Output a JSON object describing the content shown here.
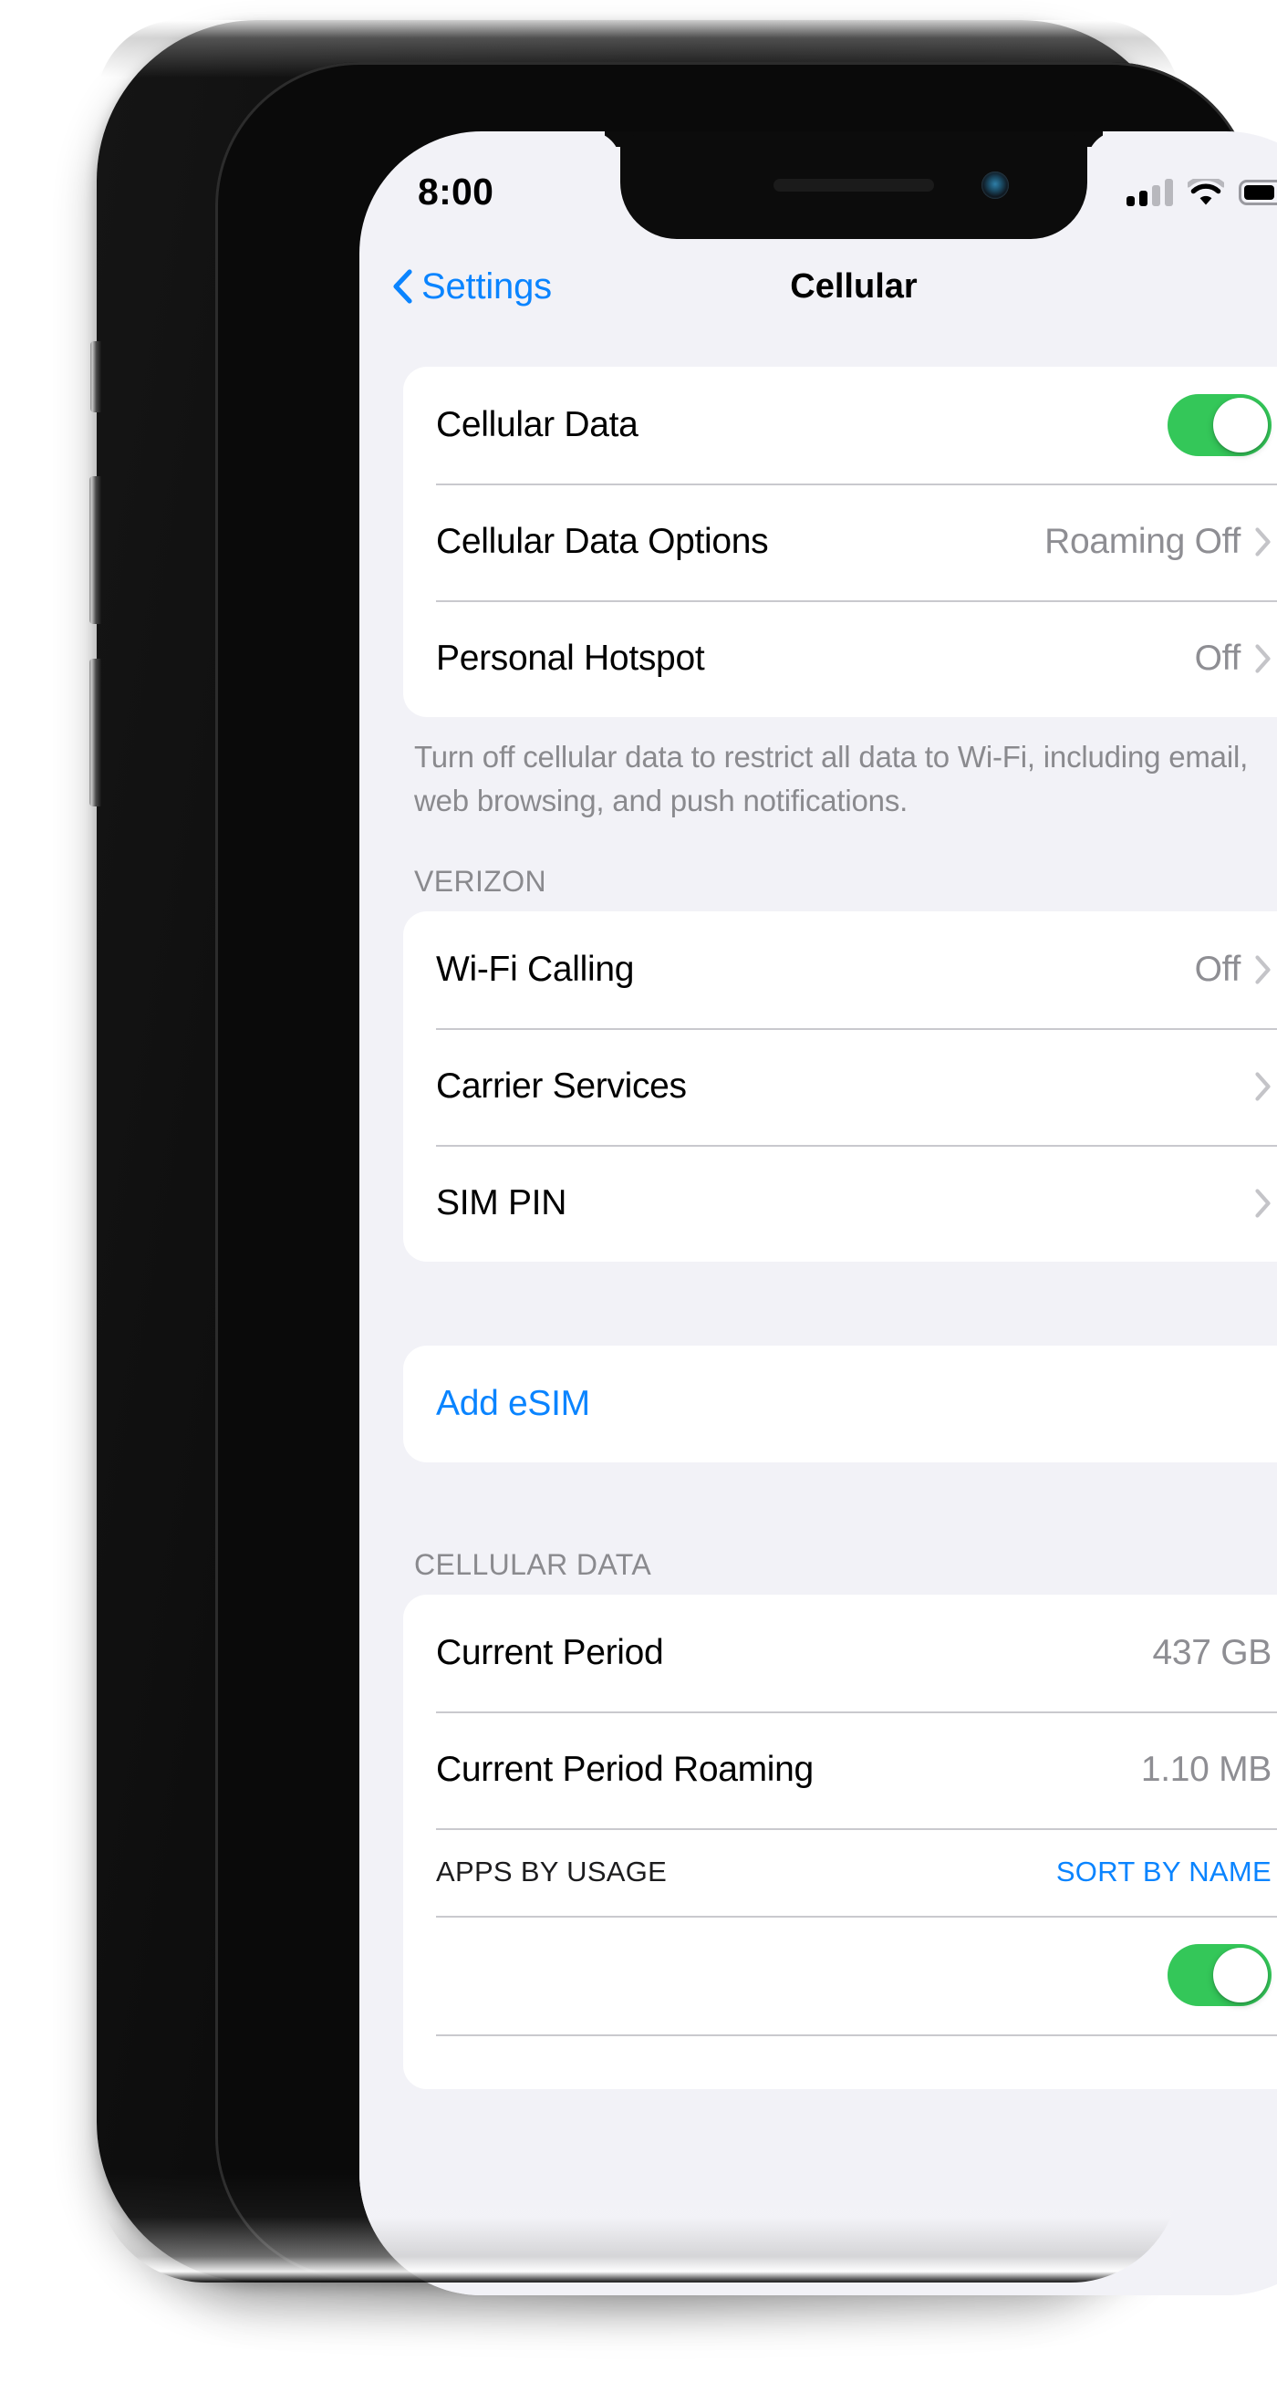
{
  "device": {
    "kind": "iphone-mockup"
  },
  "status_bar": {
    "time": "8:00",
    "signal_icon": "cellular-signal-icon",
    "signal_bars_filled": 2,
    "signal_bars_total": 4,
    "wifi_icon": "wifi-icon",
    "battery_icon": "battery-icon",
    "battery_level_percent": 76
  },
  "nav": {
    "back_icon": "chevron-left-icon",
    "back_label": "Settings",
    "title": "Cellular"
  },
  "colors": {
    "accent_blue": "#0a84ff",
    "toggle_green": "#34c759",
    "secondary_text": "#8e8e93",
    "background": "#f2f2f7"
  },
  "groups": [
    {
      "id": "cellular-main",
      "rows": [
        {
          "label": "Cellular Data",
          "control": "toggle",
          "toggle_on": true
        },
        {
          "label": "Cellular Data Options",
          "value": "Roaming Off",
          "control": "chevron"
        },
        {
          "label": "Personal Hotspot",
          "value": "Off",
          "control": "chevron"
        }
      ],
      "footer": "Turn off cellular data to restrict all data to Wi-Fi, including email, web browsing, and push notifications."
    },
    {
      "id": "carrier",
      "header": "VERIZON",
      "rows": [
        {
          "label": "Wi-Fi Calling",
          "value": "Off",
          "control": "chevron"
        },
        {
          "label": "Carrier Services",
          "value": "",
          "control": "chevron"
        },
        {
          "label": "SIM PIN",
          "value": "",
          "control": "chevron"
        }
      ]
    },
    {
      "id": "add-esim",
      "rows": [
        {
          "label": "Add eSIM",
          "control": "none",
          "style": "link"
        }
      ]
    },
    {
      "id": "cellular-data-usage",
      "header": "CELLULAR DATA",
      "rows": [
        {
          "label": "Current Period",
          "value": "437 GB",
          "control": "none"
        },
        {
          "label": "Current Period Roaming",
          "value": "1.10 MB",
          "control": "none"
        }
      ],
      "subhead": {
        "label": "APPS BY USAGE",
        "action": "SORT BY NAME"
      },
      "trailing_row": {
        "label": "",
        "control": "toggle",
        "toggle_on": true
      }
    }
  ]
}
